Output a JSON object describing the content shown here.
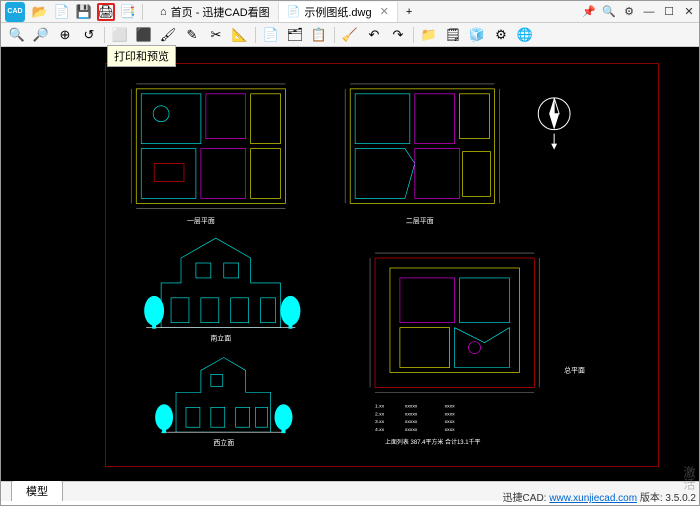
{
  "title": {
    "app_logo_text": "CAD"
  },
  "quickbar": {
    "open": "📂",
    "new": "📄",
    "save": "💾",
    "print": "🖨",
    "export": "📑"
  },
  "tabs": [
    {
      "icon": "⌂",
      "label": "首页 - 迅捷CAD看图",
      "closable": false
    },
    {
      "icon": "📄",
      "label": "示例图纸.dwg",
      "closable": true
    }
  ],
  "new_tab": "+",
  "wincontrols": {
    "pin": "📌",
    "zoom": "🔍",
    "settings": "⚙",
    "min": "—",
    "max": "☐",
    "close": "✕"
  },
  "toolbar2": {
    "b1": "🔍",
    "b2": "🔎",
    "b3": "⊕",
    "b4": "↺",
    "b5": "⬜",
    "b6": "⬛",
    "b7": "🖌",
    "b8": "✎",
    "b9": "✂",
    "b10": "📐",
    "b11": "📄",
    "b12": "🗂",
    "b13": "📋",
    "b14": "🧹",
    "b15": "↶",
    "b16": "↷",
    "b17": "📁",
    "b18": "🗒",
    "b19": "🧊",
    "b20": "⚙",
    "b21": "🌐"
  },
  "tooltip": "打印和预览",
  "model_tab": "模型",
  "status": {
    "brand": "迅捷CAD:",
    "url": "www.xunjiecad.com",
    "ver_label": "版本:",
    "ver": "3.5.0.2"
  },
  "watermark": "激活",
  "drawing_labels": {
    "p1": "一层平面",
    "p2": "二层平面",
    "e1": "南立面",
    "e2": "西立面",
    "site": "总平面"
  },
  "chart_data": {
    "type": "cad-drawing",
    "sheets": [
      {
        "name": "一层平面",
        "pos": "top-left",
        "kind": "floorplan"
      },
      {
        "name": "二层平面",
        "pos": "top-right",
        "kind": "floorplan"
      },
      {
        "name": "南立面",
        "pos": "mid-left",
        "kind": "elevation"
      },
      {
        "name": "西立面",
        "pos": "bottom-left",
        "kind": "elevation"
      },
      {
        "name": "总平面",
        "pos": "bottom-right",
        "kind": "siteplan"
      }
    ],
    "compass": true,
    "area_note": "387.4平方米"
  }
}
